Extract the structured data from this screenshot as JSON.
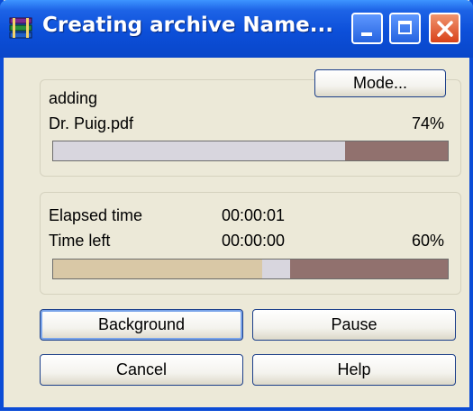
{
  "window": {
    "title": "Creating archive Name...",
    "icon": "winrar-books-icon"
  },
  "file_group": {
    "action": "adding",
    "filename": "Dr. Puig.pdf",
    "percent_text": "74%",
    "progress_fraction": 0.74,
    "mode_button": "Mode..."
  },
  "time_group": {
    "elapsed_label": "Elapsed time",
    "elapsed_value": "00:00:01",
    "left_label": "Time left",
    "left_value": "00:00:00",
    "percent_text": "60%",
    "progress_fraction": 0.6
  },
  "buttons": {
    "background": "Background",
    "pause": "Pause",
    "cancel": "Cancel",
    "help": "Help"
  },
  "colors": {
    "title_bar": "#0c4fd9",
    "progress_empty": "#91716e",
    "progress_file_fill": "#d8d6de",
    "progress_total_fill": "#d9c8a6",
    "progress_total_chunk": "#d8d6de"
  }
}
